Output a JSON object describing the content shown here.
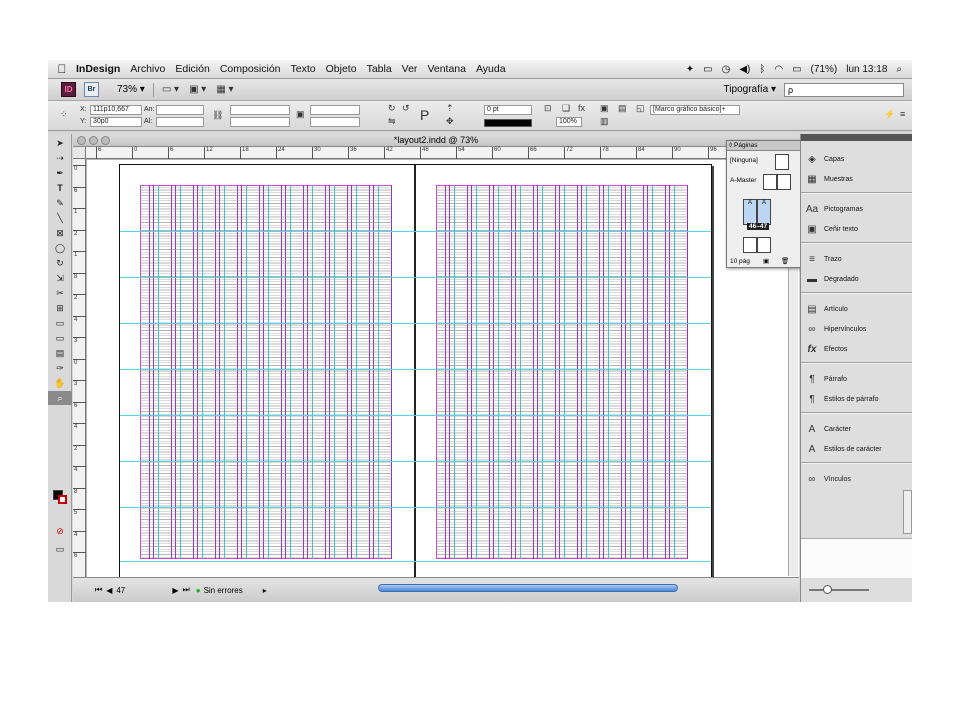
{
  "menubar": {
    "apple": "",
    "app_name": "InDesign",
    "items": [
      "Archivo",
      "Edición",
      "Composición",
      "Texto",
      "Objeto",
      "Tabla",
      "Ver",
      "Ventana",
      "Ayuda"
    ],
    "battery": "(71%)",
    "clock": "lun 13:18"
  },
  "appbar": {
    "id_logo": "ID",
    "br_logo": "Br",
    "zoom": "73% ▾",
    "view_btn_1": "▭ ▾",
    "view_btn_2": "▣ ▾",
    "view_btn_3": "▦ ▾",
    "workspace": "Tipografía ▾",
    "search_placeholder": "ρ"
  },
  "control": {
    "x_label": "X:",
    "x_value": "111p10,667",
    "y_label": "Y:",
    "y_value": "30p0",
    "w_label": "An:",
    "h_label": "Al:",
    "stroke_weight": "0 pt",
    "scale": "100%",
    "object_style": "[Marco gráfico básico]+"
  },
  "document": {
    "title": "*layout2.indd @ 73%",
    "h_ruler_ticks": [
      "6",
      "0",
      "6",
      "12",
      "18",
      "24",
      "30",
      "36",
      "42",
      "48",
      "54",
      "60",
      "66",
      "72",
      "78",
      "84",
      "90",
      "96"
    ],
    "v_ruler_ticks": [
      "0",
      "6",
      "1",
      "2",
      "1",
      "8",
      "2",
      "4",
      "3",
      "0",
      "3",
      "6",
      "4",
      "2",
      "4",
      "8",
      "5",
      "4",
      "6"
    ],
    "page_number": "47",
    "preflight": "Sin errores"
  },
  "pages_panel": {
    "tab": "◊ Páginas",
    "none": "[Ninguna]",
    "master": "A-Master",
    "spread_label": "46–47",
    "count": "10 pág",
    "a1": "A",
    "a2": "A"
  },
  "dock": {
    "panels": [
      {
        "label": "Capas",
        "icon": "layers-icon",
        "glyph": "◈"
      },
      {
        "label": "Muestras",
        "icon": "swatches-icon",
        "glyph": "▦"
      },
      {
        "label": "Pictogramas",
        "icon": "glyphs-icon",
        "glyph": "Aa"
      },
      {
        "label": "Ceñir texto",
        "icon": "text-wrap-icon",
        "glyph": "▣"
      },
      {
        "label": "Trazo",
        "icon": "stroke-icon",
        "glyph": "≡"
      },
      {
        "label": "Degradado",
        "icon": "gradient-icon",
        "glyph": "▬"
      },
      {
        "label": "Artículo",
        "icon": "article-icon",
        "glyph": "▤"
      },
      {
        "label": "Hipervínculos",
        "icon": "hyperlinks-icon",
        "glyph": "∞"
      },
      {
        "label": "Efectos",
        "icon": "effects-icon",
        "glyph": "fx"
      },
      {
        "label": "Párrafo",
        "icon": "paragraph-icon",
        "glyph": "¶"
      },
      {
        "label": "Estilos de párrafo",
        "icon": "paragraph-styles-icon",
        "glyph": "¶"
      },
      {
        "label": "Carácter",
        "icon": "character-icon",
        "glyph": "A"
      },
      {
        "label": "Estilos de carácter",
        "icon": "character-styles-icon",
        "glyph": "A"
      },
      {
        "label": "Vínculos",
        "icon": "links-icon",
        "glyph": "∞"
      }
    ]
  },
  "colors": {
    "margin_guide": "#d04ad0",
    "column_guide": "#9628c8",
    "baseline_guide": "#4fd8e6",
    "scrollbar": "#4e86d8"
  }
}
